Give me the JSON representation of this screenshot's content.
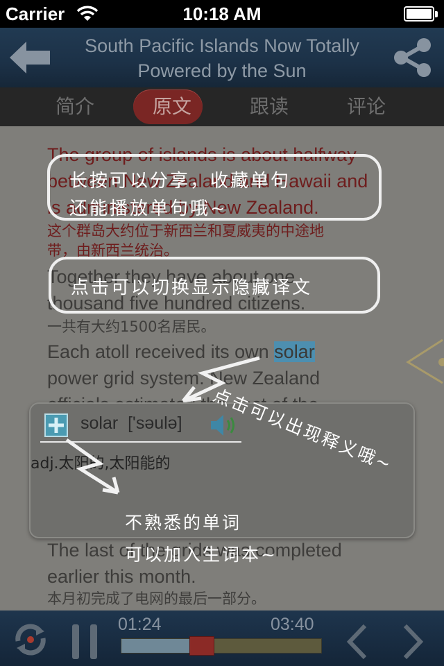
{
  "status_bar": {
    "carrier": "Carrier",
    "time": "10:18 AM"
  },
  "nav": {
    "title_line1": "South Pacific Islands Now Totally",
    "title_line2": "Powered by the Sun",
    "back_icon": "back-arrow-icon",
    "share_icon": "share-icon"
  },
  "tabs": [
    {
      "label": "简介"
    },
    {
      "label": "原文"
    },
    {
      "label": "跟读"
    },
    {
      "label": "评论"
    }
  ],
  "article": {
    "p1_en_1": "The group of islands is about halfway",
    "p1_en_2": "between New Zealand and Hawaii and",
    "p1_en_3": "is administered by New Zealand.",
    "p1_zh_1": "这个群岛大约位于新西兰和夏威夷的中途地",
    "p1_zh_2": "带，由新西兰统治。",
    "p2_en_1": "Together they have about one",
    "p2_en_2": "thousand five hundred citizens.",
    "p2_zh": "一共有大约1500名居民。",
    "p3_en_1_a": "Each atoll received its own ",
    "p3_en_1_hl": "solar",
    "p3_en_2": "power grid system. New Zealand",
    "p3_en_3": "officials estimated the cost of the",
    "p4_en_1": "The last of the grids was completed",
    "p4_en_2": "earlier this month.",
    "p4_zh": "本月初完成了电网的最后一部分。"
  },
  "tips": {
    "share_line1": "长按可以分享，收藏单句",
    "share_line2": "还能播放单句哦~",
    "toggle": "点击可以切换显示隐藏译文",
    "definition": "点击可以出现释义哦~",
    "vocab_line1": "不熟悉的单词",
    "vocab_line2": "可以加入生词本~"
  },
  "dictionary": {
    "word": "solar",
    "phonetic": "['səulə]",
    "meaning": "adj.太阳的,太阳能的",
    "add_icon": "plus-icon",
    "speaker_icon": "speaker-icon"
  },
  "player": {
    "current_time": "01:24",
    "total_time": "03:40",
    "progress": 0.4,
    "loop_icon": "repeat-icon",
    "pause_icon": "pause-icon",
    "prev_icon": "chevron-left-icon",
    "next_icon": "chevron-right-icon"
  }
}
